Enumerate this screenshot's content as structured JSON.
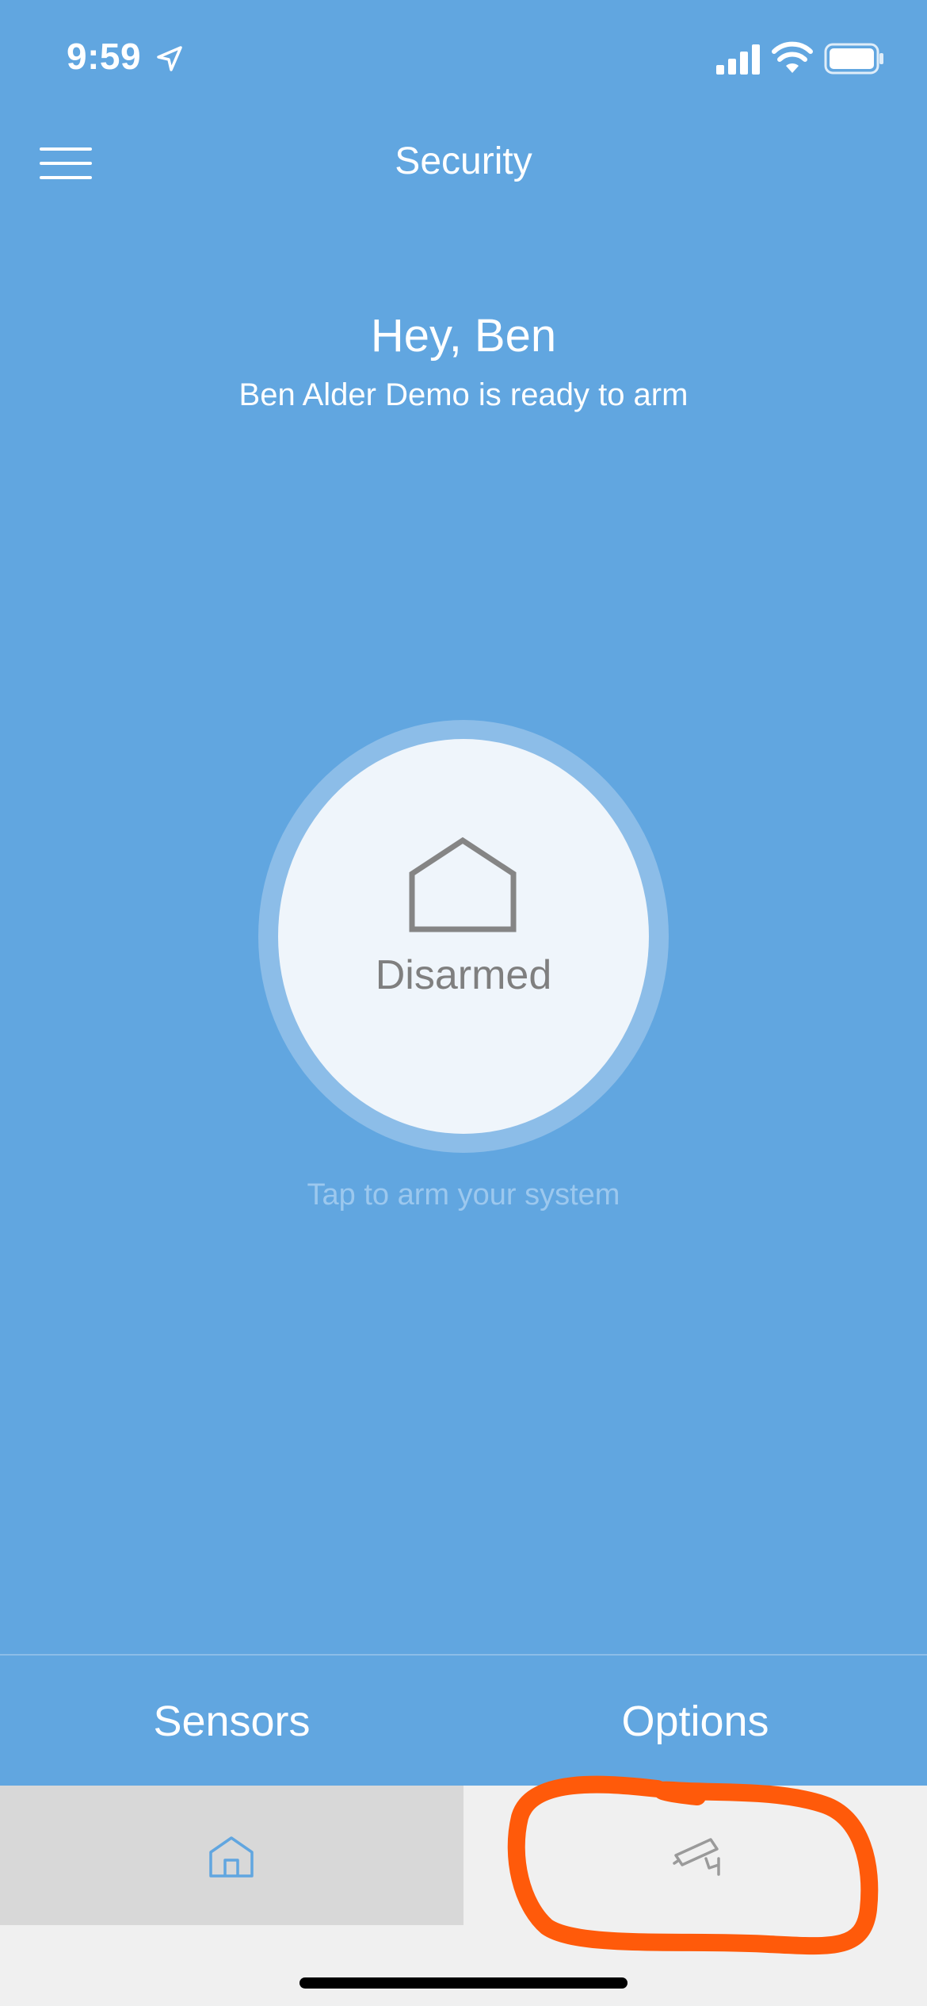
{
  "status_bar": {
    "time": "9:59",
    "icons": [
      "location-arrow-icon",
      "cellular-signal-icon",
      "wifi-icon",
      "battery-icon"
    ]
  },
  "header": {
    "menu_icon": "hamburger-menu-icon",
    "title": "Security"
  },
  "main": {
    "greeting": "Hey, Ben",
    "status_message": "Ben Alder Demo is ready to arm",
    "arm_button": {
      "icon": "house-icon",
      "state": "Disarmed",
      "hint": "Tap to arm your system"
    }
  },
  "actions": {
    "sensors_label": "Sensors",
    "options_label": "Options"
  },
  "tab_bar": {
    "tabs": [
      {
        "icon": "home-icon",
        "selected": true
      },
      {
        "icon": "security-camera-icon",
        "selected": false
      }
    ]
  },
  "colors": {
    "background": "#61a6e0",
    "ring": "#8cbde8",
    "button_face": "#eff5fb",
    "text_muted": "#7f7f7f",
    "hint_text": "#9cc8ee",
    "tab_selected_bg": "#d8d8d8",
    "tab_bar_bg": "#f0f0f0",
    "annotation": "#ff5a0a"
  }
}
